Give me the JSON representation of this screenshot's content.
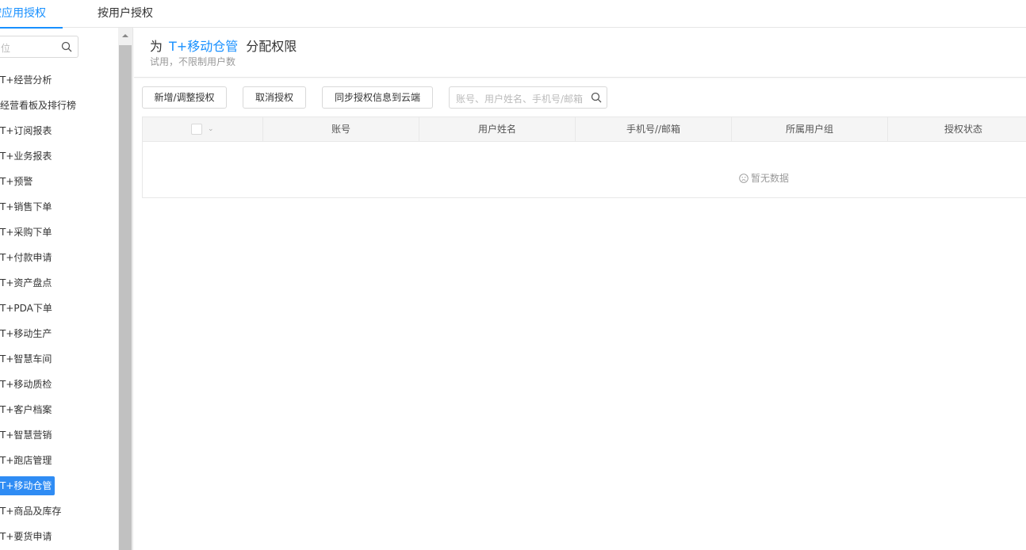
{
  "top_tabs": {
    "by_app": "按应用授权",
    "by_user": "按用户授权"
  },
  "sidebar": {
    "search_placeholder": "位",
    "items": [
      {
        "label": "T+经营分析"
      },
      {
        "label": "经营看板及排行榜"
      },
      {
        "label": "T+订阅报表"
      },
      {
        "label": "T+业务报表"
      },
      {
        "label": "T+预警"
      },
      {
        "label": "T+销售下单"
      },
      {
        "label": "T+采购下单"
      },
      {
        "label": "T+付款申请"
      },
      {
        "label": "T+资产盘点"
      },
      {
        "label": "T+PDA下单"
      },
      {
        "label": "T+移动生产"
      },
      {
        "label": "T+智慧车间"
      },
      {
        "label": "T+移动质检"
      },
      {
        "label": "T+客户档案"
      },
      {
        "label": "T+智慧营销"
      },
      {
        "label": "T+跑店管理"
      },
      {
        "label": "T+移动仓管"
      },
      {
        "label": "T+商品及库存"
      },
      {
        "label": "T+要货申请"
      }
    ],
    "active_index": 16
  },
  "header": {
    "prefix": "为",
    "app_name": "T+移动仓管",
    "suffix": "分配权限",
    "subtitle": "试用，不限制用户数"
  },
  "toolbar": {
    "add_label": "新增/调整授权",
    "cancel_label": "取消授权",
    "sync_label": "同步授权信息到云端",
    "search_placeholder": "账号、用户姓名、手机号/邮箱"
  },
  "table": {
    "columns": [
      "账号",
      "用户姓名",
      "手机号//邮箱",
      "所属用户组",
      "授权状态"
    ],
    "empty_text": "暂无数据"
  },
  "colors": {
    "accent": "#1890ff",
    "active_item_bg": "#2f8cf4"
  }
}
